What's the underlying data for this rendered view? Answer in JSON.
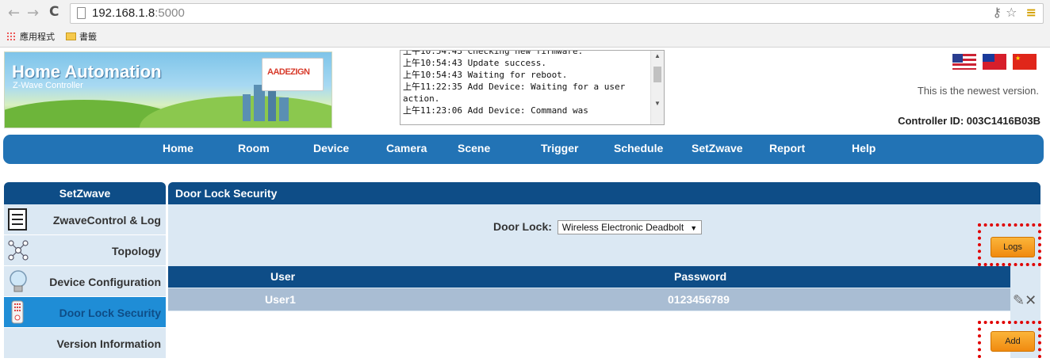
{
  "browser": {
    "back_icon": "arrow-left-icon",
    "forward_icon": "arrow-right-icon",
    "reload_icon": "reload-icon",
    "url_host": "192.168.1.8",
    "url_port": ":5000",
    "bookmarks": [
      {
        "label": "應用程式",
        "icon": "apps-icon"
      },
      {
        "label": "書籤",
        "icon": "folder-icon"
      }
    ]
  },
  "header": {
    "title": "Home Automation",
    "subtitle": "Z-Wave Controller",
    "logo_text": "AADEZIGN",
    "log_text": "上午10:54:43 Checking new firmware.\n上午10:54:43 Update success.\n上午10:54:43 Waiting for reboot.\n上午11:22:35 Add Device: Waiting for a user action.\n上午11:23:06 Add Device: Command was",
    "version_text": "This is the newest version.",
    "controller_id": "Controller ID: 003C1416B03B",
    "flags": [
      "us-flag",
      "tw-flag",
      "cn-flag"
    ]
  },
  "nav": [
    "Home",
    "Room",
    "Device",
    "Camera",
    "Scene",
    "Trigger",
    "Schedule",
    "SetZwave",
    "Report",
    "Help"
  ],
  "sidebar": {
    "title": "SetZwave",
    "items": [
      {
        "label": "ZwaveControl & Log",
        "icon": "list-icon"
      },
      {
        "label": "Topology",
        "icon": "network-icon"
      },
      {
        "label": "Device Configuration",
        "icon": "bulb-icon"
      },
      {
        "label": "Door Lock Security",
        "icon": "remote-icon",
        "active": true
      },
      {
        "label": "Version Information",
        "icon": ""
      }
    ]
  },
  "panel": {
    "title": "Door Lock Security",
    "door_lock_label": "Door Lock:",
    "door_lock_value": "Wireless Electronic Deadbolt",
    "logs_button": "Logs",
    "add_button": "Add",
    "columns": [
      "User",
      "Password"
    ],
    "rows": [
      {
        "user": "User1",
        "password": "0123456789"
      }
    ]
  },
  "colors": {
    "nav_blue": "#2273b5",
    "header_dark": "#0e4d87",
    "panel_bg": "#dbe8f3",
    "button_orange": "#f08a10",
    "highlight_red": "#e00000"
  }
}
